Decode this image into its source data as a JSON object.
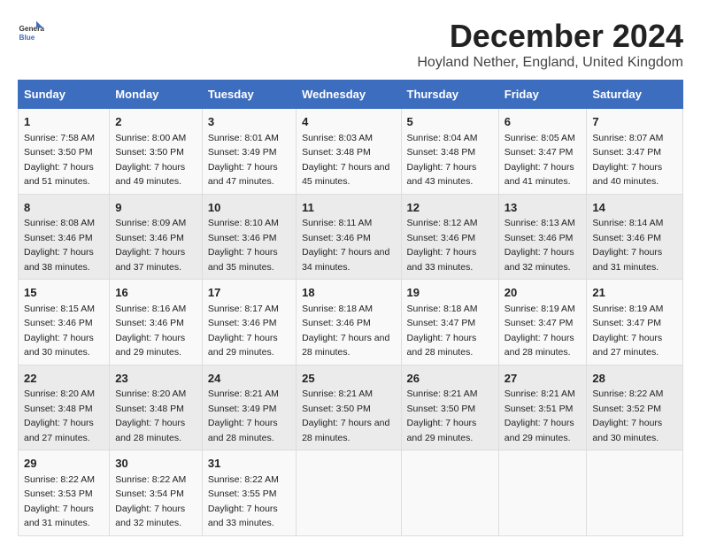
{
  "logo": {
    "line1": "General",
    "line2": "Blue"
  },
  "title": "December 2024",
  "subtitle": "Hoyland Nether, England, United Kingdom",
  "days_of_week": [
    "Sunday",
    "Monday",
    "Tuesday",
    "Wednesday",
    "Thursday",
    "Friday",
    "Saturday"
  ],
  "weeks": [
    [
      {
        "day": "1",
        "sunrise": "7:58 AM",
        "sunset": "3:50 PM",
        "daylight": "7 hours and 51 minutes."
      },
      {
        "day": "2",
        "sunrise": "8:00 AM",
        "sunset": "3:50 PM",
        "daylight": "7 hours and 49 minutes."
      },
      {
        "day": "3",
        "sunrise": "8:01 AM",
        "sunset": "3:49 PM",
        "daylight": "7 hours and 47 minutes."
      },
      {
        "day": "4",
        "sunrise": "8:03 AM",
        "sunset": "3:48 PM",
        "daylight": "7 hours and 45 minutes."
      },
      {
        "day": "5",
        "sunrise": "8:04 AM",
        "sunset": "3:48 PM",
        "daylight": "7 hours and 43 minutes."
      },
      {
        "day": "6",
        "sunrise": "8:05 AM",
        "sunset": "3:47 PM",
        "daylight": "7 hours and 41 minutes."
      },
      {
        "day": "7",
        "sunrise": "8:07 AM",
        "sunset": "3:47 PM",
        "daylight": "7 hours and 40 minutes."
      }
    ],
    [
      {
        "day": "8",
        "sunrise": "8:08 AM",
        "sunset": "3:46 PM",
        "daylight": "7 hours and 38 minutes."
      },
      {
        "day": "9",
        "sunrise": "8:09 AM",
        "sunset": "3:46 PM",
        "daylight": "7 hours and 37 minutes."
      },
      {
        "day": "10",
        "sunrise": "8:10 AM",
        "sunset": "3:46 PM",
        "daylight": "7 hours and 35 minutes."
      },
      {
        "day": "11",
        "sunrise": "8:11 AM",
        "sunset": "3:46 PM",
        "daylight": "7 hours and 34 minutes."
      },
      {
        "day": "12",
        "sunrise": "8:12 AM",
        "sunset": "3:46 PM",
        "daylight": "7 hours and 33 minutes."
      },
      {
        "day": "13",
        "sunrise": "8:13 AM",
        "sunset": "3:46 PM",
        "daylight": "7 hours and 32 minutes."
      },
      {
        "day": "14",
        "sunrise": "8:14 AM",
        "sunset": "3:46 PM",
        "daylight": "7 hours and 31 minutes."
      }
    ],
    [
      {
        "day": "15",
        "sunrise": "8:15 AM",
        "sunset": "3:46 PM",
        "daylight": "7 hours and 30 minutes."
      },
      {
        "day": "16",
        "sunrise": "8:16 AM",
        "sunset": "3:46 PM",
        "daylight": "7 hours and 29 minutes."
      },
      {
        "day": "17",
        "sunrise": "8:17 AM",
        "sunset": "3:46 PM",
        "daylight": "7 hours and 29 minutes."
      },
      {
        "day": "18",
        "sunrise": "8:18 AM",
        "sunset": "3:46 PM",
        "daylight": "7 hours and 28 minutes."
      },
      {
        "day": "19",
        "sunrise": "8:18 AM",
        "sunset": "3:47 PM",
        "daylight": "7 hours and 28 minutes."
      },
      {
        "day": "20",
        "sunrise": "8:19 AM",
        "sunset": "3:47 PM",
        "daylight": "7 hours and 28 minutes."
      },
      {
        "day": "21",
        "sunrise": "8:19 AM",
        "sunset": "3:47 PM",
        "daylight": "7 hours and 27 minutes."
      }
    ],
    [
      {
        "day": "22",
        "sunrise": "8:20 AM",
        "sunset": "3:48 PM",
        "daylight": "7 hours and 27 minutes."
      },
      {
        "day": "23",
        "sunrise": "8:20 AM",
        "sunset": "3:48 PM",
        "daylight": "7 hours and 28 minutes."
      },
      {
        "day": "24",
        "sunrise": "8:21 AM",
        "sunset": "3:49 PM",
        "daylight": "7 hours and 28 minutes."
      },
      {
        "day": "25",
        "sunrise": "8:21 AM",
        "sunset": "3:50 PM",
        "daylight": "7 hours and 28 minutes."
      },
      {
        "day": "26",
        "sunrise": "8:21 AM",
        "sunset": "3:50 PM",
        "daylight": "7 hours and 29 minutes."
      },
      {
        "day": "27",
        "sunrise": "8:21 AM",
        "sunset": "3:51 PM",
        "daylight": "7 hours and 29 minutes."
      },
      {
        "day": "28",
        "sunrise": "8:22 AM",
        "sunset": "3:52 PM",
        "daylight": "7 hours and 30 minutes."
      }
    ],
    [
      {
        "day": "29",
        "sunrise": "8:22 AM",
        "sunset": "3:53 PM",
        "daylight": "7 hours and 31 minutes."
      },
      {
        "day": "30",
        "sunrise": "8:22 AM",
        "sunset": "3:54 PM",
        "daylight": "7 hours and 32 minutes."
      },
      {
        "day": "31",
        "sunrise": "8:22 AM",
        "sunset": "3:55 PM",
        "daylight": "7 hours and 33 minutes."
      },
      {
        "day": "",
        "sunrise": "",
        "sunset": "",
        "daylight": ""
      },
      {
        "day": "",
        "sunrise": "",
        "sunset": "",
        "daylight": ""
      },
      {
        "day": "",
        "sunrise": "",
        "sunset": "",
        "daylight": ""
      },
      {
        "day": "",
        "sunrise": "",
        "sunset": "",
        "daylight": ""
      }
    ]
  ]
}
